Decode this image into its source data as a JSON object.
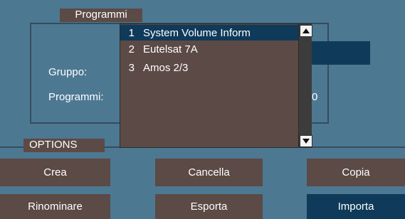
{
  "programmi_group": {
    "title": "Programmi",
    "gruppo_label": "Gruppo:",
    "programmi_label": "Programmi:",
    "programmi_value_tail": "0"
  },
  "dropdown": {
    "items": [
      {
        "number": "1",
        "label": "System Volume Inform",
        "selected": true
      },
      {
        "number": "2",
        "label": "Eutelsat 7A",
        "selected": false
      },
      {
        "number": "3",
        "label": "Amos 2/3",
        "selected": false
      }
    ]
  },
  "options": {
    "title": "OPTIONS",
    "buttons": {
      "crea": "Crea",
      "cancella": "Cancella",
      "copia": "Copia",
      "rinominare": "Rinominare",
      "esporta": "Esporta",
      "importa": "Importa"
    }
  },
  "icons": {
    "scroll_up": "scroll-up-arrow-icon",
    "scroll_down": "scroll-down-arrow-icon"
  },
  "colors": {
    "background": "#4d7892",
    "panel": "#5b4a45",
    "highlight": "#0f3a5a",
    "frame": "#344c5f"
  }
}
